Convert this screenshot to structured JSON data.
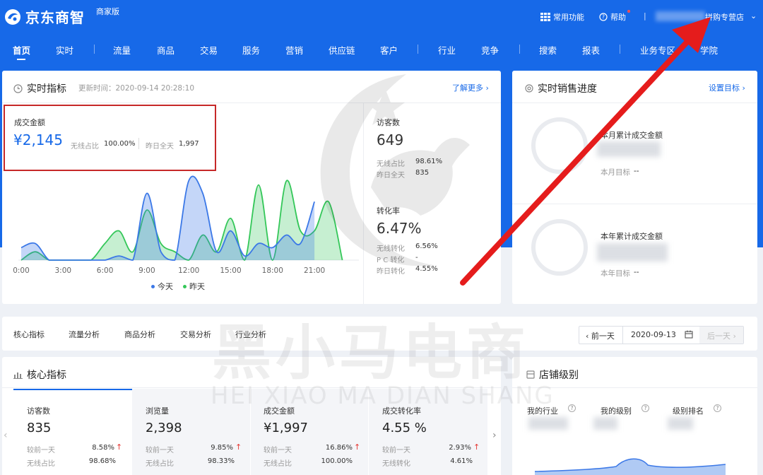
{
  "header": {
    "logo_text": "京东商智",
    "edition": "商家版",
    "common_functions": "常用功能",
    "help": "帮助",
    "separator": "|",
    "shop_name": "拼购专营店",
    "chevron": "⌄"
  },
  "nav": {
    "items": [
      "首页",
      "实时",
      "流量",
      "商品",
      "交易",
      "服务",
      "营销",
      "供应链",
      "客户",
      "行业",
      "竞争",
      "搜索",
      "报表",
      "业务专区",
      "学院"
    ],
    "active": "首页"
  },
  "realtime": {
    "title": "实时指标",
    "update_time": "更新时间：2020-09-14 20:28:10",
    "learn_more": "了解更多 ›",
    "gmv_label": "成交金额",
    "gmv_value": "¥2,145",
    "wireless_label": "无线占比",
    "wireless_value": "100.00%",
    "yesterday_label": "昨日全天",
    "yesterday_value": "1,997",
    "visitors_label": "访客数",
    "visitors_value": "649",
    "visitors_wireless_label": "无线占比",
    "visitors_wireless_value": "98.61%",
    "visitors_yesterday_label": "昨日全天",
    "visitors_yesterday_value": "835",
    "conv_label": "转化率",
    "conv_value": "6.47%",
    "conv_wireless_label": "无线转化",
    "conv_wireless_value": "6.56%",
    "conv_pc_label": "P C 转化",
    "conv_pc_value": "-",
    "conv_yesterday_label": "昨日转化",
    "conv_yesterday_value": "4.55%"
  },
  "chart_data": {
    "type": "area",
    "x": [
      "0:00",
      "3:00",
      "6:00",
      "9:00",
      "12:00",
      "15:00",
      "18:00",
      "21:00"
    ],
    "hours": [
      0,
      1,
      2,
      3,
      4,
      5,
      6,
      7,
      8,
      9,
      10,
      11,
      12,
      13,
      14,
      15,
      16,
      17,
      18,
      19,
      20,
      21,
      22,
      23
    ],
    "series": [
      {
        "name": "今天",
        "color": "#3b78e7",
        "values": [
          3,
          4,
          0,
          0,
          0,
          0,
          0,
          1,
          0,
          16,
          2,
          0,
          19,
          16,
          2,
          7,
          1,
          4,
          3,
          6,
          4,
          14,
          null,
          null
        ]
      },
      {
        "name": "昨天",
        "color": "#34c759",
        "values": [
          0,
          2,
          0,
          0,
          0,
          0,
          4,
          7,
          2,
          12,
          4,
          2,
          0,
          6,
          2,
          10,
          0,
          18,
          0,
          19,
          7,
          7,
          14,
          0
        ]
      }
    ],
    "ylim": [
      0,
      22
    ]
  },
  "sales_progress": {
    "title": "实时销售进度",
    "set_target": "设置目标 ›",
    "month_label": "本月累计成交金额",
    "month_target_label": "本月目标",
    "month_target_value": "--",
    "year_label": "本年累计成交金额",
    "year_target_label": "本年目标",
    "year_target_value": "--"
  },
  "tabs": {
    "items": [
      "核心指标",
      "流量分析",
      "商品分析",
      "交易分析",
      "行业分析"
    ],
    "prev_day": "‹ 前一天",
    "date": "2020-09-13",
    "next_day": "后一天 ›"
  },
  "core": {
    "title": "核心指标",
    "left_arrow": "‹",
    "right_arrow": "›",
    "cards": [
      {
        "label": "访客数",
        "value": "835",
        "cmp_label": "较前一天",
        "cmp_value": "8.58%",
        "share_label": "无线占比",
        "share_value": "98.68%"
      },
      {
        "label": "浏览量",
        "value": "2,398",
        "cmp_label": "较前一天",
        "cmp_value": "9.85%",
        "share_label": "无线占比",
        "share_value": "98.33%"
      },
      {
        "label": "成交金额",
        "value": "¥1,997",
        "cmp_label": "较前一天",
        "cmp_value": "16.86%",
        "share_label": "无线占比",
        "share_value": "100.00%"
      },
      {
        "label": "成交转化率",
        "value": "4.55 %",
        "cmp_label": "较前一天",
        "cmp_value": "2.93%",
        "share_label": "无线转化",
        "share_value": "4.61%"
      }
    ]
  },
  "store_level": {
    "title": "店铺级别",
    "industry_label": "我的行业",
    "level_label": "我的级别",
    "rank_label": "级别排名",
    "help_icon": "?"
  },
  "watermark": {
    "cn": "黑小马电商",
    "en": "HEI XIAO MA DIAN SHANG"
  },
  "colors": {
    "brand_blue": "#1769e8",
    "today": "#3b78e7",
    "yesterday": "#34c759",
    "up_arrow": "#e53935",
    "annotation_red": "#e51c1c"
  }
}
